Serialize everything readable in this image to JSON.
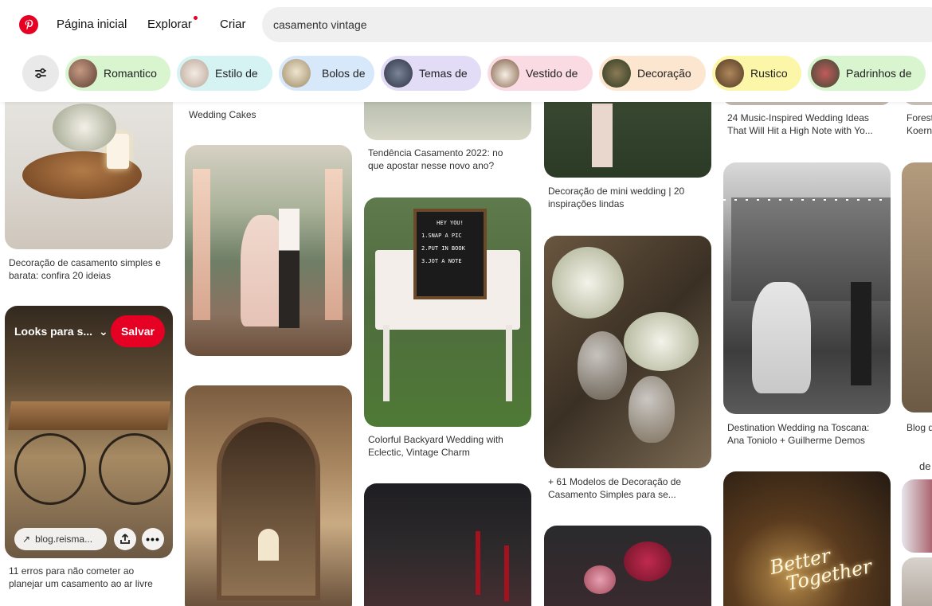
{
  "header": {
    "nav": {
      "home": "Página inicial",
      "explore": "Explorar",
      "create": "Criar"
    },
    "search": {
      "value": "casamento vintage"
    }
  },
  "filters": {
    "icon": "sliders-icon",
    "chips": [
      {
        "label": "Romantico",
        "color": "#d9f5cf"
      },
      {
        "label": "Estilo de",
        "color": "#d6f3f4"
      },
      {
        "label": "Bolos de",
        "color": "#d8e8fb"
      },
      {
        "label": "Temas de",
        "color": "#e2dcf7"
      },
      {
        "label": "Vestido de",
        "color": "#fadbe4"
      },
      {
        "label": "Decoração",
        "color": "#fde6cf"
      },
      {
        "label": "Rustico",
        "color": "#fbf6a8"
      },
      {
        "label": "Padrinhos de",
        "color": "#d9f5cf"
      }
    ]
  },
  "pins": {
    "col1": {
      "p1_caption": [
        "Decoração de casamento simples e",
        "barata: confira 20 ideias"
      ],
      "p2_board": "Looks para s...",
      "p2_save": "Salvar",
      "p2_link": "blog.reisma...",
      "p2_caption": [
        "11 erros para não cometer ao",
        "planejar um casamento ao ar livre"
      ]
    },
    "col2": {
      "top_caption": "Wedding Cakes"
    },
    "col3": {
      "p1_caption": [
        "Tendência Casamento 2022: no",
        "que apostar nesse novo ano?"
      ],
      "letterboard": [
        "HEY YOU!",
        "1.SNAP A PIC",
        "2.PUT IN BOOK",
        "3.JOT A NOTE"
      ],
      "p2_caption": [
        "Colorful Backyard Wedding with",
        "Eclectic, Vintage Charm"
      ]
    },
    "col4": {
      "p1_caption": [
        "Decoração de mini wedding | 20",
        "inspirações lindas"
      ],
      "p2_caption": [
        "+ 61 Modelos de Decoração de",
        "Casamento Simples para se..."
      ]
    },
    "col5": {
      "p1_caption": [
        "24 Music-Inspired Wedding Ideas",
        "That Will Hit a High Note with Yo..."
      ],
      "p2_caption": [
        "Destination Wedding na Toscana:",
        "Ana Toniolo + Guilherme Demos"
      ],
      "neon": [
        "Better",
        "Together"
      ]
    },
    "col6": {
      "top_caption": [
        "Forest",
        "Koern"
      ],
      "mid_caption": "Blog d",
      "fragment": "de"
    }
  },
  "colors": {
    "brand": "#e60023",
    "search_bg": "#efefef"
  }
}
